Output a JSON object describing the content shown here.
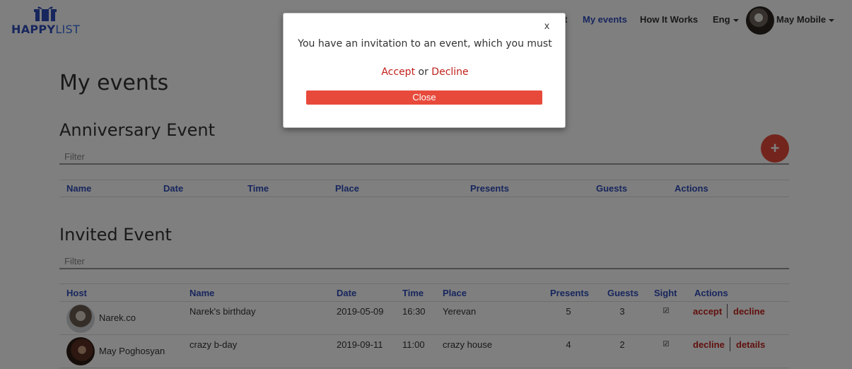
{
  "brand": {
    "logo_bold": "HAPPY",
    "logo_light": "LIST"
  },
  "nav": {
    "partial_item": "nt",
    "my_events": "My events",
    "how_it_works": "How It Works",
    "language": "Eng",
    "user_name": "May Mobile"
  },
  "page": {
    "title": "My events"
  },
  "anniversary": {
    "heading": "Anniversary Event",
    "filter_placeholder": "Filter",
    "add_label": "+",
    "columns": [
      "Name",
      "Date",
      "Time",
      "Place",
      "Presents",
      "Guests",
      "Actions"
    ]
  },
  "invited": {
    "heading": "Invited Event",
    "filter_placeholder": "Filter",
    "columns": [
      "Host",
      "Name",
      "Date",
      "Time",
      "Place",
      "Presents",
      "Guests",
      "Sight",
      "Actions"
    ],
    "rows": [
      {
        "host": "Narek.co",
        "name": "Narek's birthday",
        "date": "2019-05-09",
        "time": "16:30",
        "place": "Yerevan",
        "presents": "5",
        "guests": "3",
        "sight": true,
        "action1": "accept",
        "action2": "decline"
      },
      {
        "host": "May Poghosyan",
        "name": "crazy b-day",
        "date": "2019-09-11",
        "time": "11:00",
        "place": "crazy house",
        "presents": "4",
        "guests": "2",
        "sight": true,
        "action1": "decline",
        "action2": "details"
      }
    ]
  },
  "modal": {
    "close_x": "x",
    "message": "You have an invitation to an event, which you must",
    "accept": "Accept",
    "or": "or",
    "decline": "Decline",
    "close_button": "Close"
  },
  "colors": {
    "brand": "#2f4dbb",
    "accent": "#e74a3b",
    "action": "#c0211b"
  }
}
